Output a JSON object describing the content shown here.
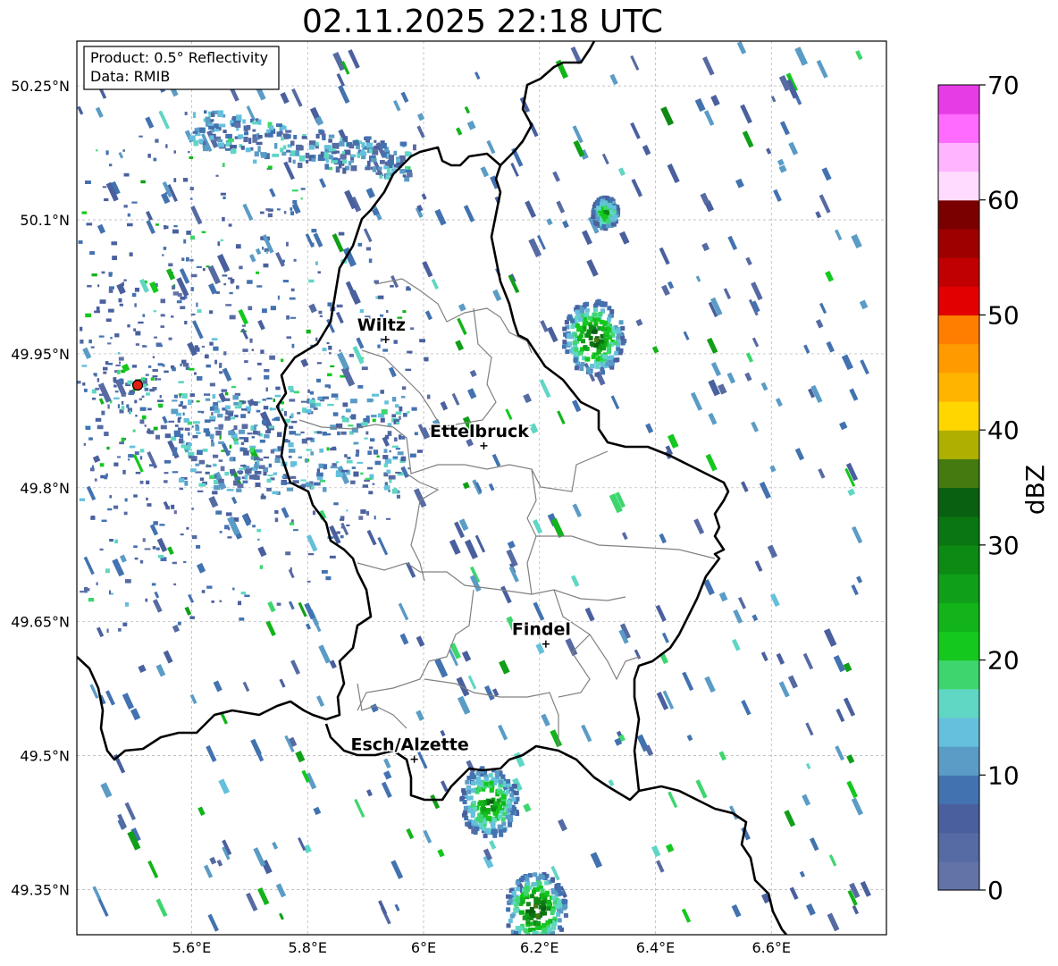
{
  "title": "02.11.2025 22:18 UTC",
  "info_box": {
    "line1": "Product: 0.5° Reflectivity",
    "line2": "Data: RMIB"
  },
  "map": {
    "lon_range": [
      5.4,
      6.8
    ],
    "lat_range": [
      49.3,
      50.3
    ],
    "lon_ticks": [
      "5.6°E",
      "5.8°E",
      "6°E",
      "6.2°E",
      "6.4°E",
      "6.6°E"
    ],
    "lat_ticks": [
      "49.35°N",
      "49.5°N",
      "49.65°N",
      "49.8°N",
      "49.95°N",
      "50.1°N",
      "50.25°N"
    ],
    "grid": true,
    "cities": [
      {
        "name": "Wiltz",
        "lon": 5.935,
        "lat": 49.966
      },
      {
        "name": "Ettelbruck",
        "lon": 6.104,
        "lat": 49.847
      },
      {
        "name": "Findel",
        "lon": 6.211,
        "lat": 49.625
      },
      {
        "name": "Esch/Alzette",
        "lon": 5.984,
        "lat": 49.496
      }
    ],
    "radar_site": {
      "lon": 5.505,
      "lat": 49.914,
      "color": "#e02010"
    },
    "reflectivity_cores": [
      {
        "lon": 6.11,
        "lat": 49.45,
        "peak_dbz": 25
      },
      {
        "lon": 6.19,
        "lat": 49.33,
        "peak_dbz": 32
      },
      {
        "lon": 6.31,
        "lat": 50.11,
        "peak_dbz": 22
      },
      {
        "lon": 6.29,
        "lat": 49.97,
        "peak_dbz": 30
      }
    ]
  },
  "colorbar": {
    "label": "dBZ",
    "min": 0,
    "max": 70,
    "ticks": [
      "0",
      "10",
      "20",
      "30",
      "40",
      "50",
      "60",
      "70"
    ],
    "colors": [
      "#6373a8",
      "#566aa3",
      "#4a609e",
      "#4272b0",
      "#5a9cc6",
      "#64c0dc",
      "#60d6c4",
      "#3dd66e",
      "#14c81e",
      "#12b41a",
      "#109f18",
      "#0d8a14",
      "#0a7612",
      "#086010",
      "#457a10",
      "#adb000",
      "#ffd600",
      "#ffb400",
      "#ff9a00",
      "#ff7e00",
      "#e20000",
      "#c00000",
      "#9e0000",
      "#7a0000",
      "#ffdcff",
      "#ffb4ff",
      "#ff6aff",
      "#e63ce6"
    ]
  }
}
